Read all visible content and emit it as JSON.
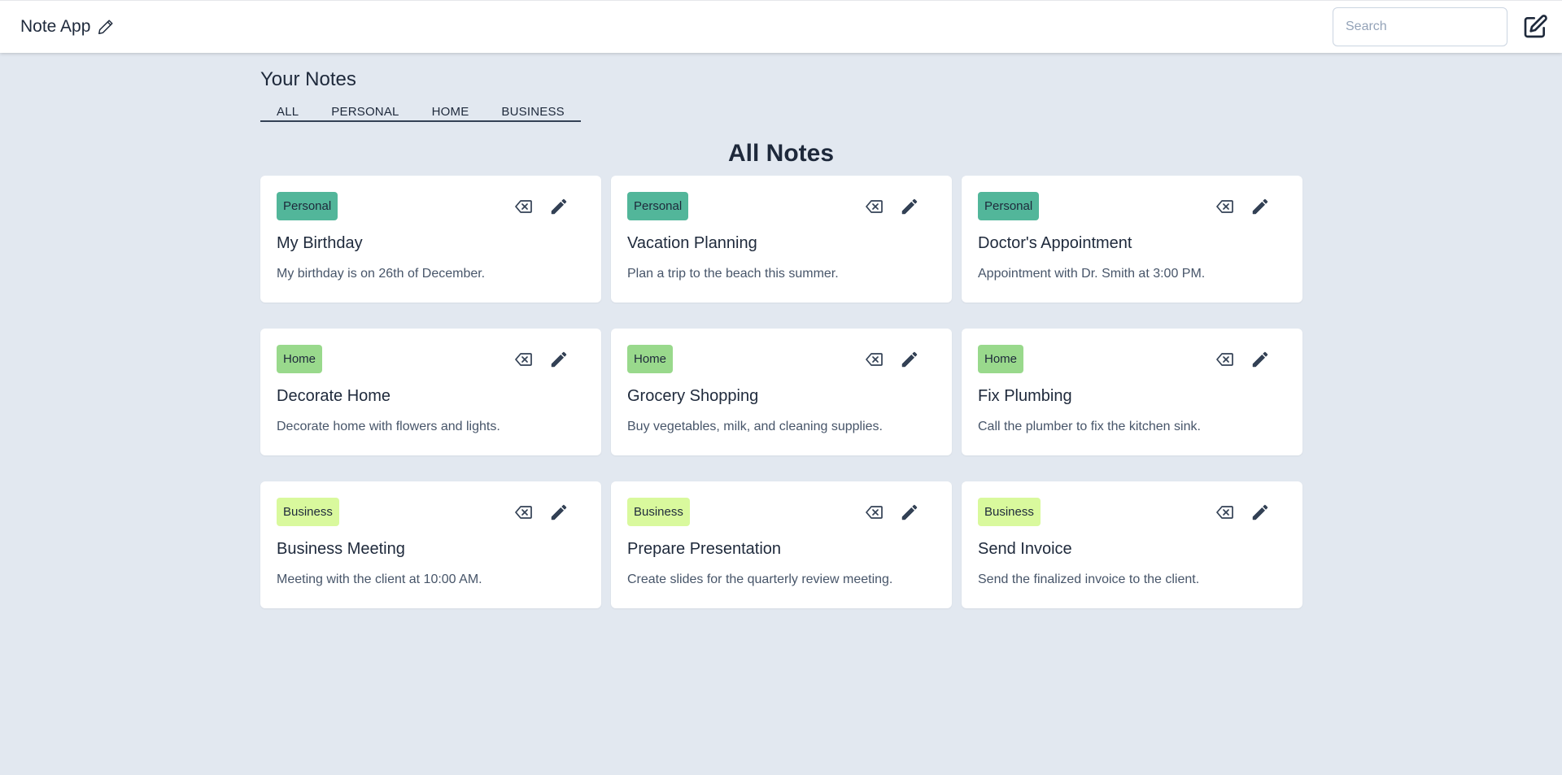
{
  "header": {
    "app_title": "Note App",
    "search_placeholder": "Search"
  },
  "section": {
    "title": "Your Notes",
    "tabs": [
      "ALL",
      "PERSONAL",
      "HOME",
      "BUSINESS"
    ]
  },
  "main": {
    "title": "All Notes",
    "notes": [
      {
        "category": "Personal",
        "title": "My Birthday",
        "desc": "My birthday is on 26th of December."
      },
      {
        "category": "Personal",
        "title": "Vacation Planning",
        "desc": "Plan a trip to the beach this summer."
      },
      {
        "category": "Personal",
        "title": "Doctor's Appointment",
        "desc": "Appointment with Dr. Smith at 3:00 PM."
      },
      {
        "category": "Home",
        "title": "Decorate Home",
        "desc": "Decorate home with flowers and lights."
      },
      {
        "category": "Home",
        "title": "Grocery Shopping",
        "desc": "Buy vegetables, milk, and cleaning supplies."
      },
      {
        "category": "Home",
        "title": "Fix Plumbing",
        "desc": "Call the plumber to fix the kitchen sink."
      },
      {
        "category": "Business",
        "title": "Business Meeting",
        "desc": "Meeting with the client at 10:00 AM."
      },
      {
        "category": "Business",
        "title": "Prepare Presentation",
        "desc": "Create slides for the quarterly review meeting."
      },
      {
        "category": "Business",
        "title": "Send Invoice",
        "desc": "Send the finalized invoice to the client."
      }
    ]
  },
  "colors": {
    "background": "#e2e8f0",
    "personal_badge": "#52b69a",
    "home_badge": "#99d98c",
    "business_badge": "#d9f99d"
  },
  "icons": {
    "brand": "pencil-icon",
    "new_note": "edit-square-icon",
    "delete": "backspace-x-icon",
    "edit": "pencil-icon"
  }
}
